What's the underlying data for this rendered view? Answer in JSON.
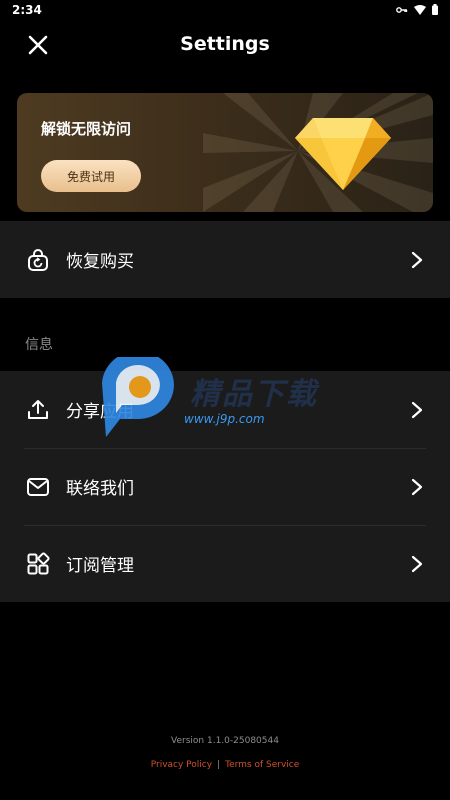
{
  "status_bar": {
    "time": "2:34"
  },
  "header": {
    "title": "Settings"
  },
  "promo": {
    "title": "解锁无限访问",
    "button_label": "免费试用"
  },
  "menu_top": [
    {
      "label": "恢复购买",
      "icon": "lock-refresh-icon"
    }
  ],
  "section": {
    "label": "信息"
  },
  "menu_info": [
    {
      "label": "分享应用",
      "icon": "upload-icon"
    },
    {
      "label": "联络我们",
      "icon": "mail-icon"
    },
    {
      "label": "订阅管理",
      "icon": "grid-icon"
    }
  ],
  "watermark": {
    "text": "精品下载",
    "url": "www.j9p.com"
  },
  "footer": {
    "version": "Version 1.1.0-25080544",
    "privacy": "Privacy Policy",
    "separator": "|",
    "terms": "Terms of Service"
  },
  "colors": {
    "background": "#000000",
    "card": "#1b1b1b",
    "link": "#d0502c",
    "promo_button": "#f3d1a6"
  }
}
